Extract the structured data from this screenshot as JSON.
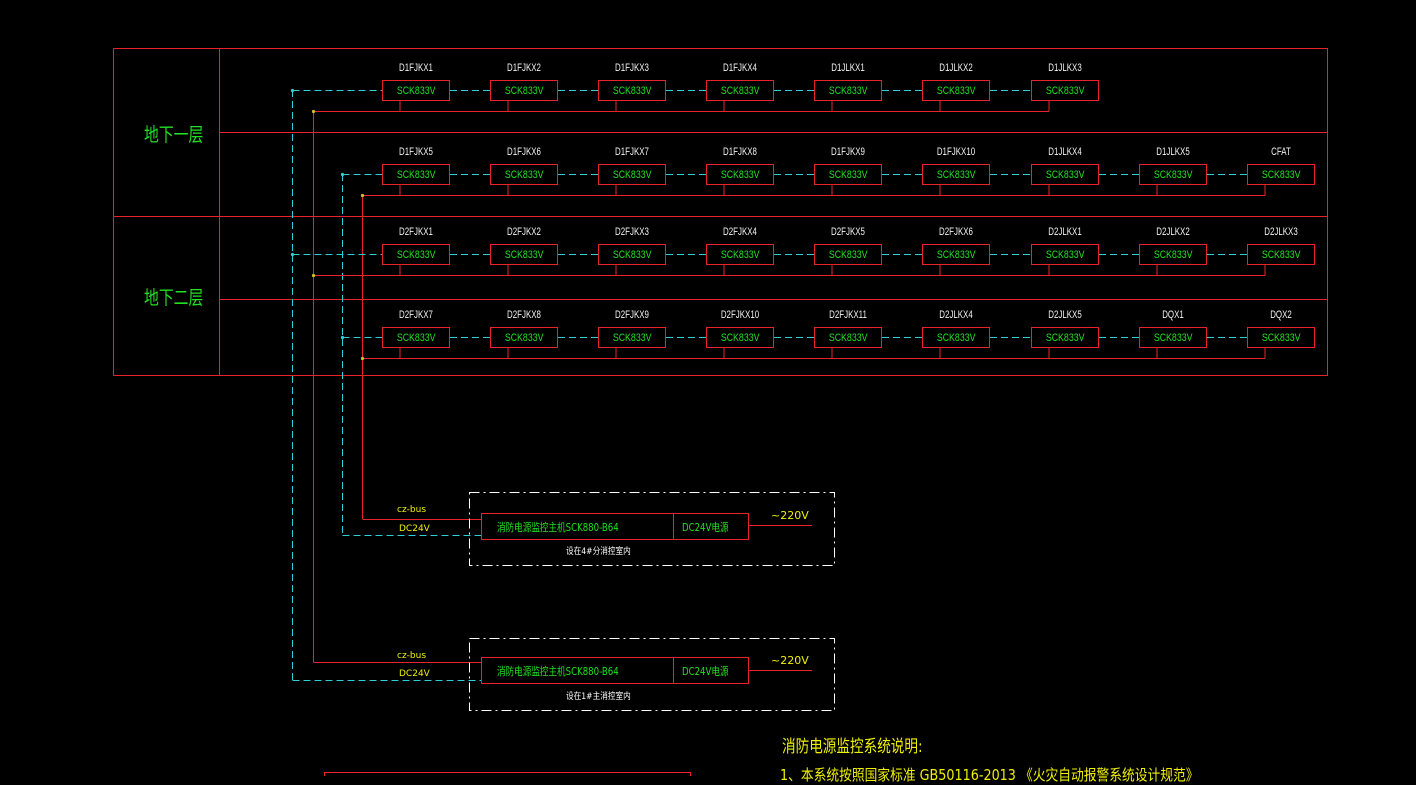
{
  "floors": [
    {
      "label": "地下一层"
    },
    {
      "label": "地下二层"
    }
  ],
  "rows": [
    {
      "modules": [
        "D1FJKX1",
        "D1FJKX2",
        "D1FJKX3",
        "D1FJKX4",
        "D1JLKX1",
        "D1JLKX2",
        "D1JLKX3"
      ]
    },
    {
      "modules": [
        "D1FJKX5",
        "D1FJKX6",
        "D1FJKX7",
        "D1FJKX8",
        "D1FJKX9",
        "D1FJKX10",
        "D1JLKX4",
        "D1JLKX5",
        "CFAT"
      ]
    },
    {
      "modules": [
        "D2FJKX1",
        "D2FJKX2",
        "D2FJKX3",
        "D2FJKX4",
        "D2FJKX5",
        "D2FJKX6",
        "D2JLKX1",
        "D2JLKX2",
        "D2JLKX3"
      ]
    },
    {
      "modules": [
        "D2FJKX7",
        "D2FJKX8",
        "D2FJKX9",
        "D2FJKX10",
        "D2FJKX11",
        "D2JLKX4",
        "D2JLKX5",
        "DQX1",
        "DQX2"
      ]
    }
  ],
  "module_model": "SCK833V",
  "controllers": [
    {
      "host": "消防电源监控主机SCK880-B64",
      "psu": "DC24V电源",
      "ac": "~220V",
      "bus": "cz-bus",
      "dc": "DC24V",
      "location": "设在4#分消控室内"
    },
    {
      "host": "消防电源监控主机SCK880-B64",
      "psu": "DC24V电源",
      "ac": "~220V",
      "bus": "cz-bus",
      "dc": "DC24V",
      "location": "设在1#主消控室内"
    }
  ],
  "notes": {
    "title": "消防电源监控系统说明:",
    "line1": "1、本系统按照国家标准  GB50116-2013  《火灾自动报警系统设计规范》"
  },
  "colors": {
    "frame": "#e8232a",
    "bus_line": "#e8232a",
    "dc_line": "#2ecfd6",
    "module_text": "#22e022",
    "label_text": "#f2f2f2",
    "note_text": "#f0f000"
  }
}
